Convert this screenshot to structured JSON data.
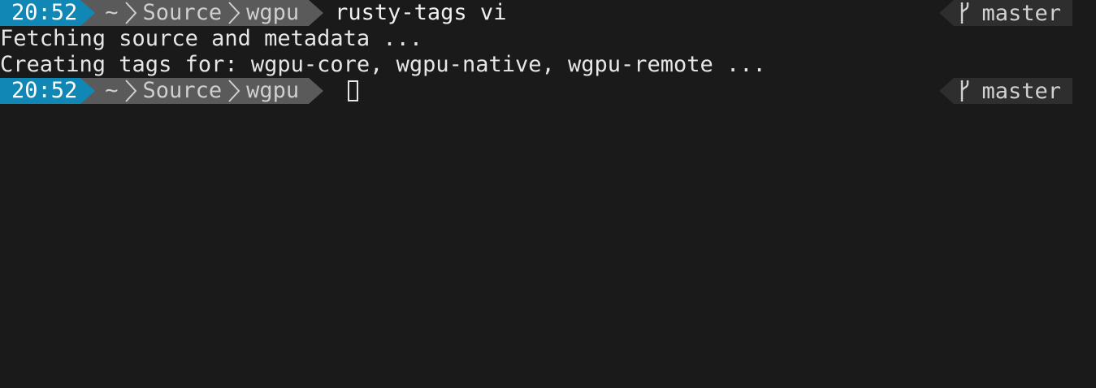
{
  "prompt1": {
    "time": "20:52",
    "path": [
      "~",
      "Source",
      "wgpu"
    ],
    "command": "rusty-tags vi",
    "branch": "master"
  },
  "output": [
    "Fetching source and metadata ...",
    "Creating tags for: wgpu-core, wgpu-native, wgpu-remote ..."
  ],
  "prompt2": {
    "time": "20:52",
    "path": [
      "~",
      "Source",
      "wgpu"
    ],
    "command": "",
    "branch": "master"
  },
  "icons": {
    "branch": "git-branch-icon",
    "separator": "chevron-right-icon"
  },
  "colors": {
    "background": "#1a1a1a",
    "time_segment": "#1187b5",
    "path_segment": "#5a5a5a",
    "git_segment": "#2e2e2e"
  }
}
